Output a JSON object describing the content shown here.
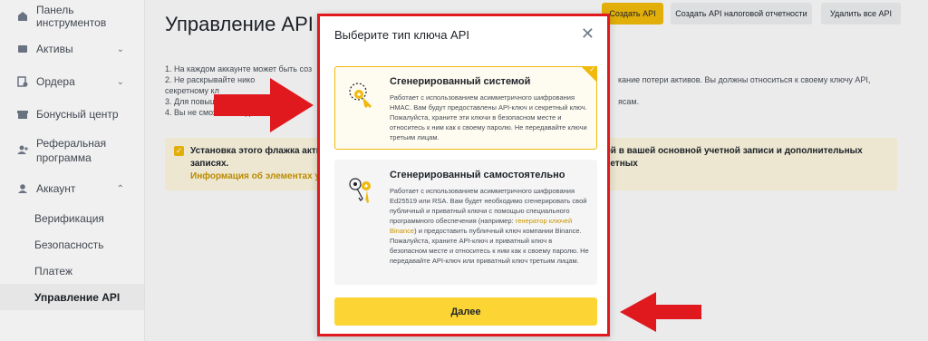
{
  "sidebar": {
    "items": [
      {
        "label": "Панель инструментов",
        "icon": "dashboard-icon"
      },
      {
        "label": "Активы",
        "icon": "wallet-icon"
      },
      {
        "label": "Ордера",
        "icon": "orders-icon"
      },
      {
        "label": "Бонусный центр",
        "icon": "gift-icon"
      },
      {
        "label": "Реферальная программа",
        "icon": "add-user-icon"
      },
      {
        "label": "Аккаунт",
        "icon": "user-icon"
      }
    ],
    "account_sub": [
      "Верификация",
      "Безопасность",
      "Платеж",
      "Управление API"
    ]
  },
  "page": {
    "title": "Управление API",
    "buttons": {
      "create": "Создать API",
      "create_tax": "Создать API налоговой отчетности",
      "delete_all": "Удалить все API"
    },
    "notes_left": [
      "1. На каждом аккаунте может быть соз",
      "2. Не раскрывайте нико",
      "секретному кл",
      "3. Для повыш",
      "4. Вы не сможете создат"
    ],
    "notes_right": [
      "кание потери активов. Вы должны относиться к своему ключу API,",
      "",
      "",
      "ясам."
    ],
    "warning": {
      "text": "Установка этого флажка актив",
      "text_right": "лей в вашей основной учетной записи и дополнительных учетных",
      "text_line2": "записях.",
      "link": "Информация об элементах управ"
    }
  },
  "modal": {
    "title": "Выберите тип ключа API",
    "close": "✕",
    "options": [
      {
        "title": "Сгенерированный системой",
        "desc": "Работает с использованием асимметричного шифрования HMAC. Вам будут предоставлены API-ключ и секретный ключ. Пожалуйста, храните эти ключи в безопасном месте и относитесь к ним как к своему паролю. Не передавайте ключи третьим лицам.",
        "selected": true
      },
      {
        "title": "Сгенерированный самостоятельно",
        "desc_before": "Работает с использованием асимметричного шифрования Ed25519 или RSA. Вам будет необходимо сгенерировать свой публичный и приватный ключи с помощью специального программного обеспечения (например: ",
        "desc_link": "генератор ключей Binance",
        "desc_after": ") и предоставить публичный ключ компании Binance. Пожалуйста, храните API-ключ и приватный ключ в безопасном месте и относитесь к ним как к своему паролю. Не передавайте API-ключ или приватный ключ третьим лицам.",
        "selected": false
      }
    ],
    "next": "Далее"
  },
  "colors": {
    "accent": "#f0b90b",
    "button_yellow": "#fcd535",
    "highlight_red": "#e0191f"
  }
}
